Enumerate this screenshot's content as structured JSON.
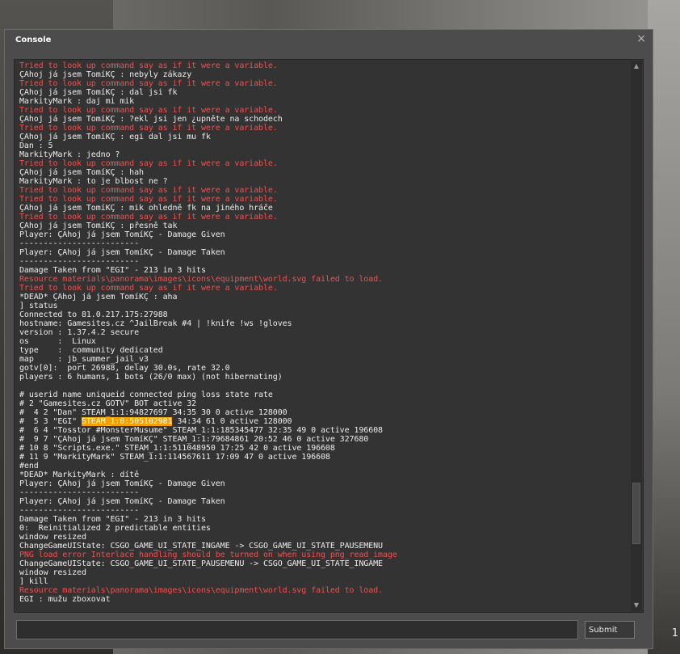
{
  "window": {
    "title": "Console",
    "close_glyph": "×"
  },
  "background": {
    "corner_number": "1"
  },
  "log": [
    {
      "text": "Tried to look up command say as if it were a variable.",
      "type": "error"
    },
    {
      "text": "ÇAhoj já jsem TomíKÇ : nebyly zákazy",
      "type": "normal"
    },
    {
      "text": "Tried to look up command say as if it were a variable.",
      "type": "error"
    },
    {
      "text": "ÇAhoj já jsem TomíKÇ : dal jsi fk",
      "type": "normal"
    },
    {
      "text": "MarkityMark : daj mi mik",
      "type": "normal"
    },
    {
      "text": "Tried to look up command say as if it were a variable.",
      "type": "error"
    },
    {
      "text": "ÇAhoj já jsem TomíKÇ : ?ekl jsi jen ¿upněte na schodech",
      "type": "normal"
    },
    {
      "text": "Tried to look up command say as if it were a variable.",
      "type": "error"
    },
    {
      "text": "ÇAhoj já jsem TomíKÇ : egi dal jsi mu fk",
      "type": "normal"
    },
    {
      "text": "Dan : 5",
      "type": "normal"
    },
    {
      "text": "MarkityMark : jedno ?",
      "type": "normal"
    },
    {
      "text": "Tried to look up command say as if it were a variable.",
      "type": "error"
    },
    {
      "text": "ÇAhoj já jsem TomíKÇ : hah",
      "type": "normal"
    },
    {
      "text": "MarkityMark : to je blbost ne ?",
      "type": "normal"
    },
    {
      "text": "Tried to look up command say as if it were a variable.",
      "type": "error"
    },
    {
      "text": "Tried to look up command say as if it were a variable.",
      "type": "error"
    },
    {
      "text": "ÇAhoj já jsem TomíKÇ : mik ohledně fk na jiného hráče",
      "type": "normal"
    },
    {
      "text": "Tried to look up command say as if it were a variable.",
      "type": "error"
    },
    {
      "text": "ÇAhoj já jsem TomíKÇ : přesně tak",
      "type": "normal"
    },
    {
      "text": "Player: ÇAhoj já jsem TomíKÇ - Damage Given",
      "type": "normal"
    },
    {
      "text": "-------------------------",
      "type": "normal"
    },
    {
      "text": "Player: ÇAhoj já jsem TomíKÇ - Damage Taken",
      "type": "normal"
    },
    {
      "text": "-------------------------",
      "type": "normal"
    },
    {
      "text": "Damage Taken from \"EGI\" - 213 in 3 hits",
      "type": "normal"
    },
    {
      "text": "Resource materials\\panorama\\images\\icons\\equipment\\world.svg failed to load.",
      "type": "error"
    },
    {
      "text": "Tried to look up command say as if it were a variable.",
      "type": "error"
    },
    {
      "text": "*DEAD* ÇAhoj já jsem TomíKÇ : aha",
      "type": "normal"
    },
    {
      "text": "] status",
      "type": "normal"
    },
    {
      "text": "Connected to 81.0.217.175:27988",
      "type": "normal"
    },
    {
      "text": "hostname: Gamesites.cz ^JailBreak #4 | !knife !ws !gloves",
      "type": "normal"
    },
    {
      "text": "version : 1.37.4.2 secure",
      "type": "normal"
    },
    {
      "text": "os      :  Linux",
      "type": "normal"
    },
    {
      "text": "type    :  community dedicated",
      "type": "normal"
    },
    {
      "text": "map     : jb_summer_jail_v3",
      "type": "normal"
    },
    {
      "text": "gotv[0]:  port 26988, delay 30.0s, rate 32.0",
      "type": "normal"
    },
    {
      "text": "players : 6 humans, 1 bots (26/0 max) (not hibernating)",
      "type": "normal"
    },
    {
      "text": "",
      "type": "normal"
    },
    {
      "text": "# userid name uniqueid connected ping loss state rate",
      "type": "normal"
    },
    {
      "text": "# 2 \"Gamesites.cz GOTV\" BOT active 32",
      "type": "normal"
    },
    {
      "text": "#  4 2 \"Dan\" STEAM_1:1:94827697 34:35 30 0 active 128000",
      "type": "normal"
    },
    {
      "text": "#  5 3 \"EGI\" ",
      "type": "normal",
      "highlight": "STEAM_1:0:505102981",
      "suffix": " 34:34 61 0 active 128000"
    },
    {
      "text": "#  6 4 \"Tosstor #MonsterMusume\" STEAM_1:1:185345477 32:35 49 0 active 196608",
      "type": "normal"
    },
    {
      "text": "#  9 7 \"ÇAhoj já jsem TomíKÇ\" STEAM_1:1:79684861 20:52 46 0 active 327680",
      "type": "normal"
    },
    {
      "text": "# 10 8 \"Scripts.exe.\" STEAM_1:1:511048950 17:25 42 0 active 196608",
      "type": "normal"
    },
    {
      "text": "# 11 9 \"MarkityMark\" STEAM_1:1:114567611 17:09 47 0 active 196608",
      "type": "normal"
    },
    {
      "text": "#end",
      "type": "normal"
    },
    {
      "text": "*DEAD* MarkityMark : dítě",
      "type": "normal"
    },
    {
      "text": "Player: ÇAhoj já jsem TomíKÇ - Damage Given",
      "type": "normal"
    },
    {
      "text": "-------------------------",
      "type": "normal"
    },
    {
      "text": "Player: ÇAhoj já jsem TomíKÇ - Damage Taken",
      "type": "normal"
    },
    {
      "text": "-------------------------",
      "type": "normal"
    },
    {
      "text": "Damage Taken from \"EGI\" - 213 in 3 hits",
      "type": "normal"
    },
    {
      "text": "0:  Reinitialized 2 predictable entities",
      "type": "normal"
    },
    {
      "text": "window resized",
      "type": "normal"
    },
    {
      "text": "ChangeGameUIState: CSGO_GAME_UI_STATE_INGAME -> CSGO_GAME_UI_STATE_PAUSEMENU",
      "type": "normal"
    },
    {
      "text": "PNG load error Interlace handling should be turned on when using png_read_image",
      "type": "error"
    },
    {
      "text": "ChangeGameUIState: CSGO_GAME_UI_STATE_PAUSEMENU -> CSGO_GAME_UI_STATE_INGAME",
      "type": "normal"
    },
    {
      "text": "window resized",
      "type": "normal"
    },
    {
      "text": "] kill",
      "type": "normal"
    },
    {
      "text": "Resource materials\\panorama\\images\\icons\\equipment\\world.svg failed to load.",
      "type": "error"
    },
    {
      "text": "EGI : mužu zboxovat",
      "type": "normal"
    }
  ],
  "scrollbar": {
    "up_icon": "▲",
    "down_icon": "▼",
    "position_fraction": 0.88
  },
  "input": {
    "value": "",
    "placeholder": ""
  },
  "submit": {
    "label": "Submit"
  },
  "colors": {
    "error": "#f05050",
    "normal": "#ececec",
    "highlight": "#f5a000",
    "panel": "#4c4c4c",
    "log_bg": "#333333"
  }
}
